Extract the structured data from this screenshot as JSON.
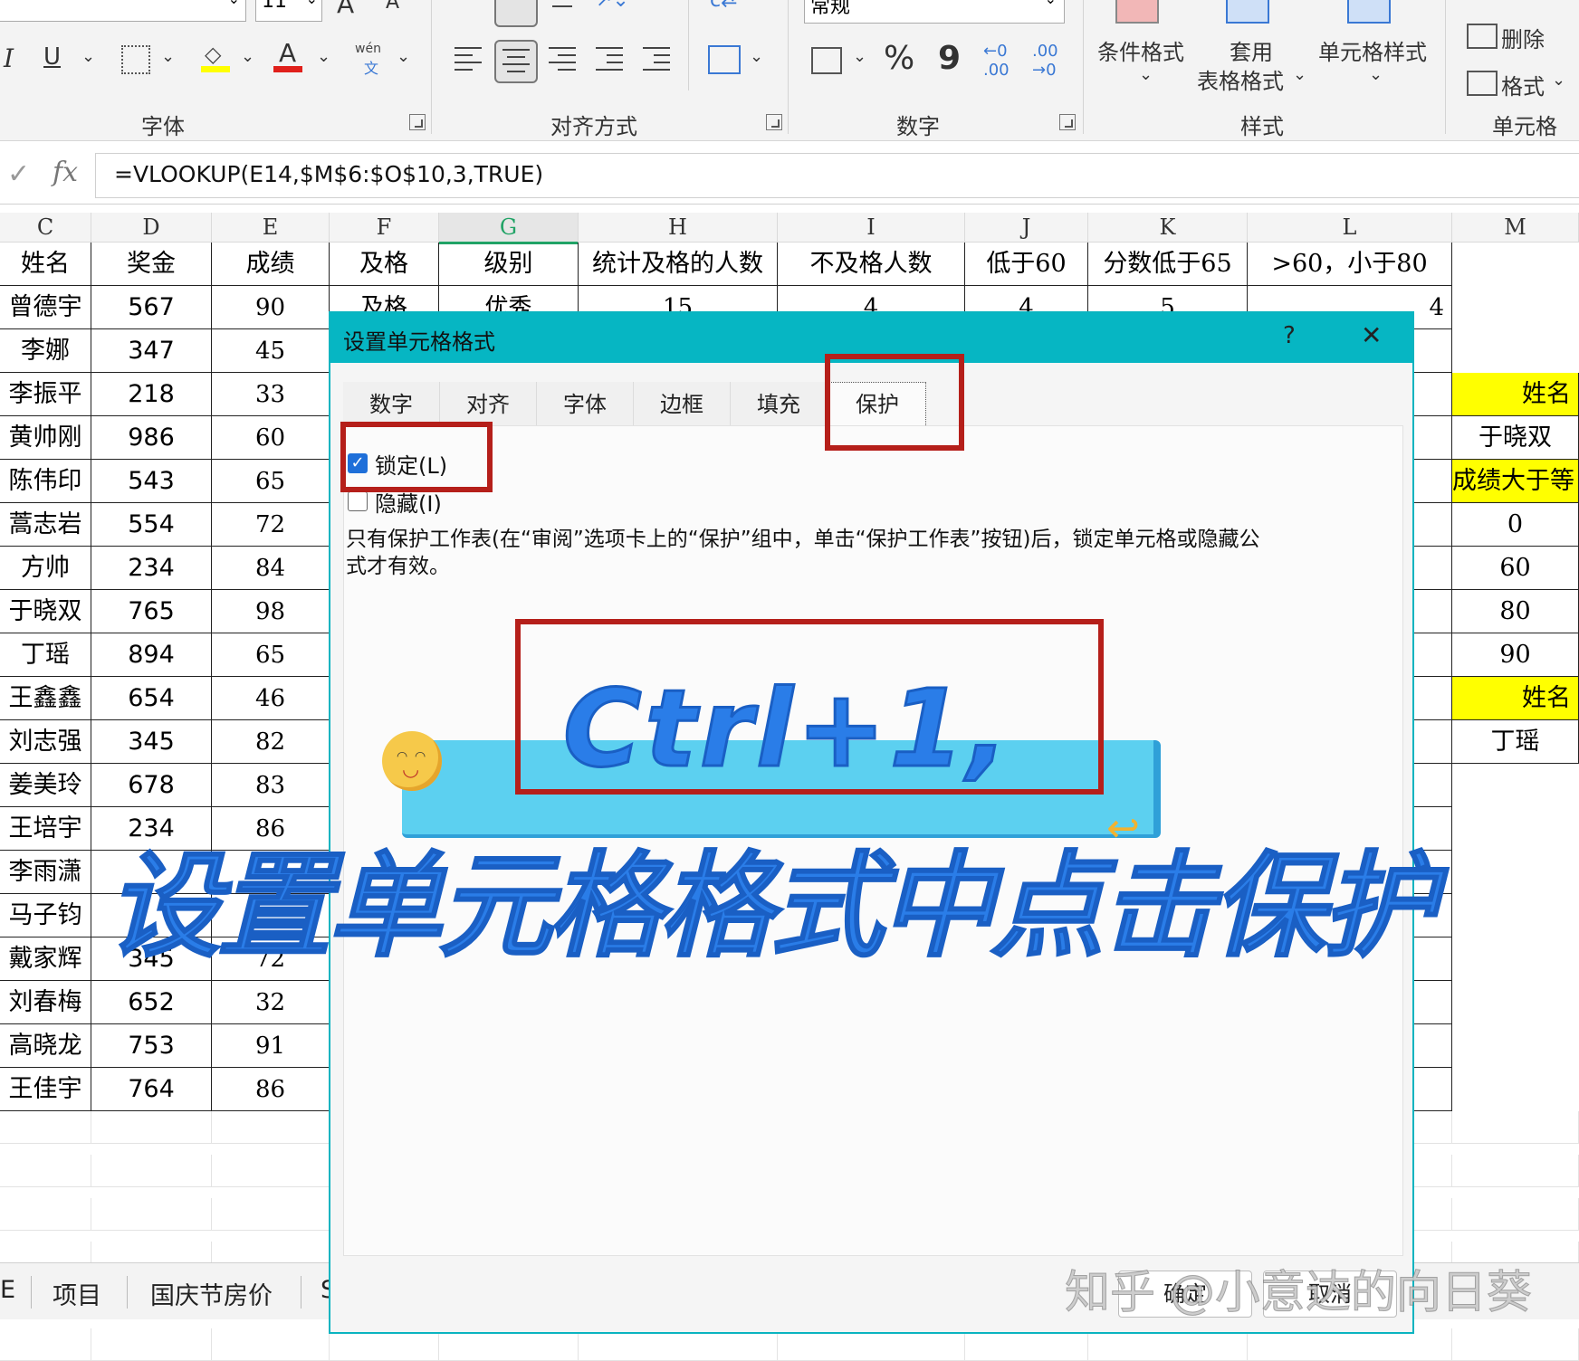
{
  "ribbon": {
    "groups": {
      "font": "字体",
      "align": "对齐方式",
      "number": "数字",
      "styles": "样式",
      "cells": "单元格"
    },
    "font_size": "11",
    "number_format": "常规",
    "styles_buttons": {
      "conditional": "条件格式",
      "table_line1": "套用",
      "table_line2": "表格格式",
      "cell_style": "单元格样式"
    },
    "cells_buttons": {
      "delete": "删除",
      "format": "格式"
    },
    "percent": "%",
    "comma": "9",
    "wen": "wén",
    "wen_char": "文"
  },
  "formula_bar": {
    "fx": "fx",
    "formula": "=VLOOKUP(E14,$M$6:$O$10,3,TRUE)"
  },
  "columns": [
    "C",
    "D",
    "E",
    "F",
    "G",
    "H",
    "I",
    "J",
    "K",
    "L",
    "M"
  ],
  "table": {
    "headers": [
      "姓名",
      "奖金",
      "成绩",
      "及格",
      "级别",
      "统计及格的人数",
      "不及格人数",
      "低于60",
      "分数低于65",
      ">60，小于80"
    ],
    "first_row_partial": [
      "及格",
      "优秀",
      "15",
      "4",
      "4",
      "5"
    ],
    "l_value": "4",
    "rows": [
      [
        "曾德宇",
        "567",
        "90"
      ],
      [
        "李娜",
        "347",
        "45"
      ],
      [
        "李振平",
        "218",
        "33"
      ],
      [
        "黄帅刚",
        "986",
        "60"
      ],
      [
        "陈伟印",
        "543",
        "65"
      ],
      [
        "蒿志岩",
        "554",
        "72"
      ],
      [
        "方帅",
        "234",
        "84"
      ],
      [
        "于晓双",
        "765",
        "98"
      ],
      [
        "丁瑶",
        "894",
        "65"
      ],
      [
        "王鑫鑫",
        "654",
        "46"
      ],
      [
        "刘志强",
        "345",
        "82"
      ],
      [
        "姜美玲",
        "678",
        "83"
      ],
      [
        "王培宇",
        "234",
        "86"
      ],
      [
        "李雨潇",
        "",
        ""
      ],
      [
        "马子钧",
        "",
        ""
      ],
      [
        "戴家辉",
        "345",
        "72"
      ],
      [
        "刘春梅",
        "652",
        "32"
      ],
      [
        "高晓龙",
        "753",
        "91"
      ],
      [
        "王佳宇",
        "764",
        "86"
      ]
    ],
    "partial_row14_values": [
      "234",
      "86"
    ],
    "partial_row16_values": [
      "",
      "91"
    ]
  },
  "side_m": [
    {
      "text": "姓名",
      "highlight": true
    },
    {
      "text": "于晓双",
      "highlight": false
    },
    {
      "text": "成绩大于等",
      "highlight": true
    },
    {
      "text": "0",
      "highlight": false
    },
    {
      "text": "60",
      "highlight": false
    },
    {
      "text": "80",
      "highlight": false
    },
    {
      "text": "90",
      "highlight": false
    },
    {
      "text": "姓名",
      "highlight": true
    },
    {
      "text": "丁瑶",
      "highlight": false
    }
  ],
  "sheet_tabs": [
    "E",
    "项目",
    "国庆节房价",
    "S"
  ],
  "dialog": {
    "title": "设置单元格格式",
    "help": "?",
    "close": "✕",
    "tabs": [
      "数字",
      "对齐",
      "字体",
      "边框",
      "填充",
      "保护"
    ],
    "active_tab": "保护",
    "locked_label": "锁定(L)",
    "locked_checked": true,
    "hidden_label": "隐藏(I)",
    "hidden_checked": false,
    "note": "只有保护工作表(在“审阅”选项卡上的“保护”组中，单击“保护工作表”按钮)后，锁定单元格或隐藏公式才有效。",
    "ok": "确定",
    "cancel": "取消"
  },
  "overlay": {
    "shortcut": "Ctrl+1,",
    "caption": "设置单元格格式中点击保护",
    "watermark": "知乎 @小意达的向日葵"
  },
  "colors": {
    "accent": "#06b6c3",
    "red_box": "#b51f1a",
    "caption_blue": "#2a7de8",
    "banner_blue": "#5cd0f0",
    "yellow": "#ffff00"
  }
}
